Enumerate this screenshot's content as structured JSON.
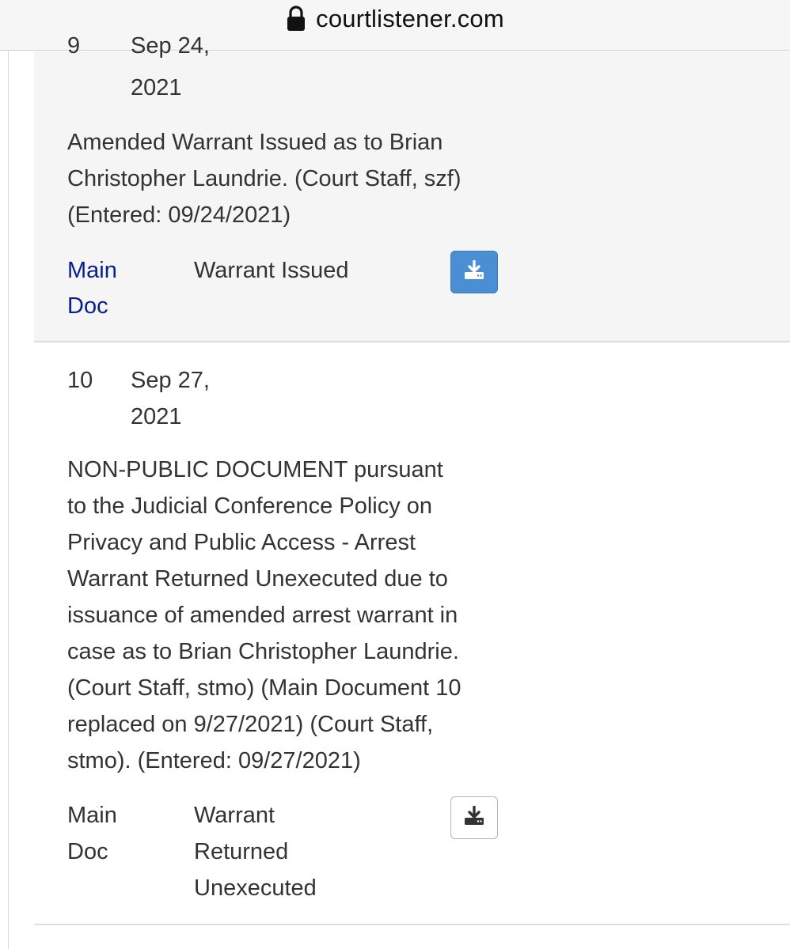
{
  "browser": {
    "domain": "courtlistener.com"
  },
  "entries": [
    {
      "number": "9",
      "date_line1": "Sep 24,",
      "date_line2": "2021",
      "description_lines": [
        "Amended Warrant Issued as to Brian",
        "Christopher Laundrie. (Court Staff, szf)",
        "(Entered: 09/24/2021)"
      ],
      "doc_label_line1": "Main",
      "doc_label_line2": "Doc",
      "doc_description_lines": [
        "Warrant Issued"
      ]
    },
    {
      "number": "10",
      "date_line1": "Sep 27,",
      "date_line2": "2021",
      "description_lines": [
        "NON-PUBLIC DOCUMENT pursuant",
        "to the Judicial Conference Policy on",
        "Privacy and Public Access - Arrest",
        "Warrant Returned Unexecuted due to",
        "issuance of amended arrest warrant in",
        "case as to Brian Christopher Laundrie.",
        "(Court Staff, stmo) (Main Document 10",
        "replaced on 9/27/2021) (Court Staff,",
        "stmo). (Entered: 09/27/2021)"
      ],
      "doc_label_line1": "Main",
      "doc_label_line2": "Doc",
      "doc_description_lines": [
        "Warrant",
        "Returned",
        "Unexecuted"
      ]
    }
  ],
  "colors": {
    "link": "#0a1e8c",
    "primary_button": "#4a8fd3",
    "highlight_row": "#f5f5f5"
  },
  "icons": {
    "lock": "lock-icon",
    "download": "download-icon"
  }
}
